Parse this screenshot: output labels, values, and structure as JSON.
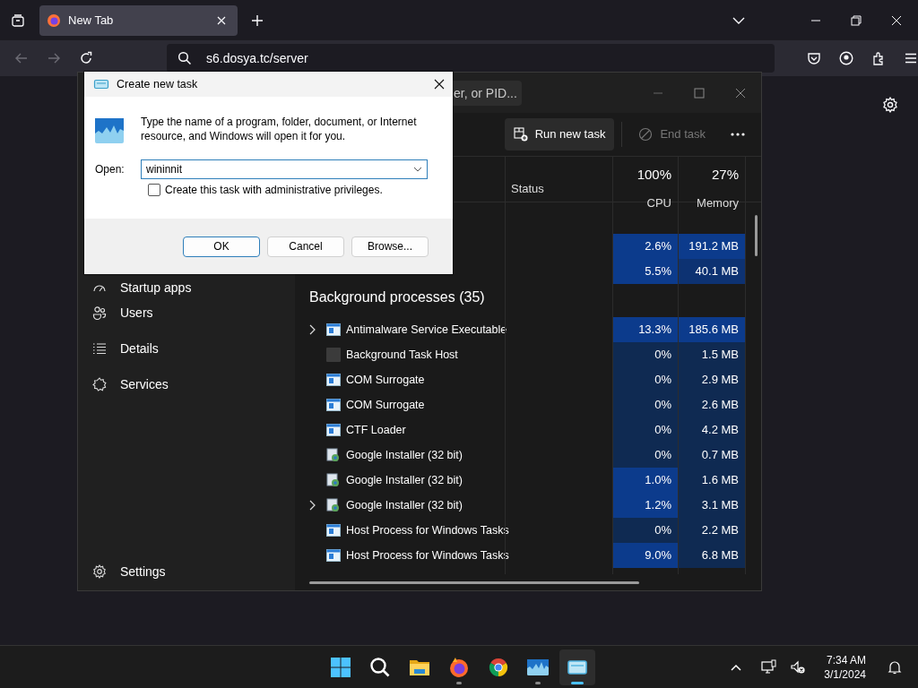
{
  "browser": {
    "tab": {
      "title": "New Tab"
    },
    "address": "s6.dosya.tc/server"
  },
  "task_manager": {
    "search_placeholder": "er, or PID...",
    "toolbar": [
      {
        "kind": "run",
        "label": "Run new task",
        "disabled": false
      },
      {
        "kind": "end",
        "label": "End task",
        "disabled": true
      }
    ],
    "columns": {
      "status": "Status",
      "cpu": {
        "total": "100%",
        "label": "CPU"
      },
      "memory": {
        "total": "27%",
        "label": "Memory"
      }
    },
    "sidebar": [
      {
        "kind": "startup",
        "label": "Startup apps"
      },
      {
        "kind": "users",
        "label": "Users"
      },
      {
        "kind": "details",
        "label": "Details"
      },
      {
        "kind": "services",
        "label": "Services"
      }
    ],
    "settings": {
      "label": "Settings"
    },
    "app_rows": [
      {
        "cpu": {
          "value": "2.6%",
          "color": "#0c3b8c"
        },
        "memory": {
          "value": "191.2 MB",
          "color": "#0c3b8c"
        }
      },
      {
        "cpu": {
          "value": "5.5%",
          "color": "#0c3b8c"
        },
        "memory": {
          "value": "40.1 MB",
          "color": "#0d3272"
        }
      }
    ],
    "background_processes": {
      "title": "Background processes (35)",
      "rows": [
        {
          "name": "Antimalware Service Executable",
          "kind": "window",
          "expandable": true,
          "cpu": {
            "value": "13.3%",
            "color": "#0c3b8c"
          },
          "memory": {
            "value": "185.6 MB",
            "color": "#0c3b8c"
          }
        },
        {
          "name": "Background Task Host",
          "kind": "blank",
          "expandable": false,
          "cpu": {
            "value": "0%",
            "color": "#0f2a52"
          },
          "memory": {
            "value": "1.5 MB",
            "color": "#0f2a52"
          }
        },
        {
          "name": "COM Surrogate",
          "kind": "window",
          "expandable": false,
          "cpu": {
            "value": "0%",
            "color": "#0f2a52"
          },
          "memory": {
            "value": "2.9 MB",
            "color": "#0f2a52"
          }
        },
        {
          "name": "COM Surrogate",
          "kind": "window",
          "expandable": false,
          "cpu": {
            "value": "0%",
            "color": "#0f2a52"
          },
          "memory": {
            "value": "2.6 MB",
            "color": "#0f2a52"
          }
        },
        {
          "name": "CTF Loader",
          "kind": "window",
          "expandable": false,
          "cpu": {
            "value": "0%",
            "color": "#0f2a52"
          },
          "memory": {
            "value": "4.2 MB",
            "color": "#0f2a52"
          }
        },
        {
          "name": "Google Installer (32 bit)",
          "kind": "installer",
          "expandable": false,
          "cpu": {
            "value": "0%",
            "color": "#0f2a52"
          },
          "memory": {
            "value": "0.7 MB",
            "color": "#0f2a52"
          }
        },
        {
          "name": "Google Installer (32 bit)",
          "kind": "installer",
          "expandable": false,
          "cpu": {
            "value": "1.0%",
            "color": "#0c3b8c"
          },
          "memory": {
            "value": "1.6 MB",
            "color": "#0f2a52"
          }
        },
        {
          "name": "Google Installer (32 bit)",
          "kind": "installer",
          "expandable": true,
          "cpu": {
            "value": "1.2%",
            "color": "#0c3b8c"
          },
          "memory": {
            "value": "3.1 MB",
            "color": "#0f2a52"
          }
        },
        {
          "name": "Host Process for Windows Tasks",
          "kind": "window",
          "expandable": false,
          "cpu": {
            "value": "0%",
            "color": "#0f2a52"
          },
          "memory": {
            "value": "2.2 MB",
            "color": "#0f2a52"
          }
        },
        {
          "name": "Host Process for Windows Tasks",
          "kind": "window",
          "expandable": false,
          "cpu": {
            "value": "9.0%",
            "color": "#0c3b8c"
          },
          "memory": {
            "value": "6.8 MB",
            "color": "#0f2a52"
          }
        }
      ]
    }
  },
  "dialog": {
    "title": "Create new task",
    "message": "Type the name of a program, folder, document, or Internet resource, and Windows will open it for you.",
    "open_label": "Open:",
    "value": "wininnit",
    "admin_checkbox": {
      "label": "Create this task with administrative privileges.",
      "checked": false
    },
    "buttons": [
      {
        "label": "OK",
        "default": true
      },
      {
        "label": "Cancel",
        "default": false
      },
      {
        "label": "Browse...",
        "default": false
      }
    ]
  },
  "taskbar": {
    "apps": [
      {
        "kind": "start",
        "running": false,
        "active": false
      },
      {
        "kind": "search",
        "running": false,
        "active": false
      },
      {
        "kind": "folder",
        "running": false,
        "active": false
      },
      {
        "kind": "firefox",
        "running": true,
        "active": false
      },
      {
        "kind": "chrome",
        "running": false,
        "active": false
      },
      {
        "kind": "taskmgr",
        "running": true,
        "active": false
      },
      {
        "kind": "run",
        "running": true,
        "active": true
      }
    ],
    "time": "7:34 AM",
    "date": "3/1/2024"
  }
}
